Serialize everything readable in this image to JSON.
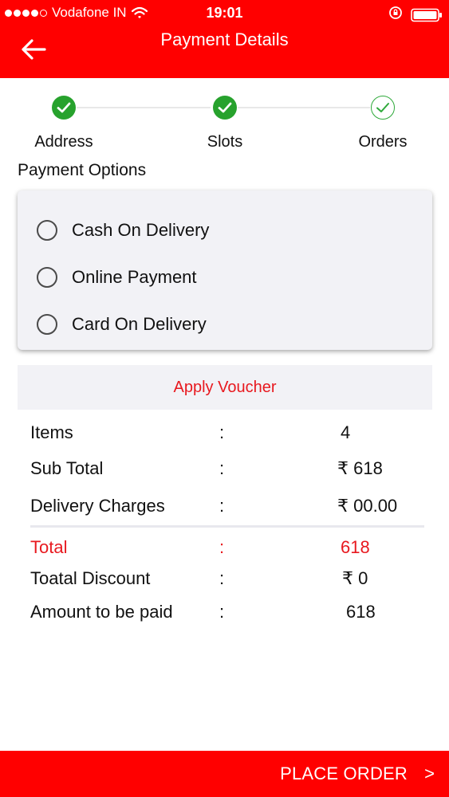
{
  "status_bar": {
    "carrier": "Vodafone IN",
    "time": "19:01"
  },
  "header": {
    "title": "Payment Details"
  },
  "stepper": {
    "steps": [
      {
        "label": "Address",
        "state": "done"
      },
      {
        "label": "Slots",
        "state": "done"
      },
      {
        "label": "Orders",
        "state": "pending"
      }
    ]
  },
  "payment": {
    "title": "Payment Options",
    "options": [
      {
        "label": "Cash On Delivery",
        "selected": false
      },
      {
        "label": "Online Payment",
        "selected": false
      },
      {
        "label": "Card On Delivery",
        "selected": false
      }
    ]
  },
  "voucher": {
    "label": "Apply Voucher"
  },
  "summary": {
    "rows": [
      {
        "label": "Items",
        "colon": ":",
        "value": "4"
      },
      {
        "label": "Sub Total",
        "colon": ":",
        "value": "₹ 618"
      },
      {
        "label": "Delivery Charges",
        "colon": ":",
        "value": "₹ 00.00"
      },
      {
        "label": "Total",
        "colon": ":",
        "value": "618"
      },
      {
        "label": "Toatal Discount",
        "colon": ":",
        "value": "₹ 0"
      },
      {
        "label": "Amount to be paid",
        "colon": ":",
        "value": "618"
      }
    ]
  },
  "footer": {
    "place_order_label": "PLACE ORDER",
    "chevron": ">"
  },
  "colors": {
    "brand_red": "#ff0000",
    "accent_red_text": "#e8191f",
    "step_done_green": "#27a22d"
  },
  "icons": {
    "back": "arrow-left-icon",
    "step_done": "check-circle-icon",
    "step_pending": "check-circle-outline-icon",
    "radio": "radio-unselected-icon",
    "wifi": "wifi-icon",
    "battery": "battery-icon",
    "lock_rotation": "rotation-lock-icon"
  }
}
